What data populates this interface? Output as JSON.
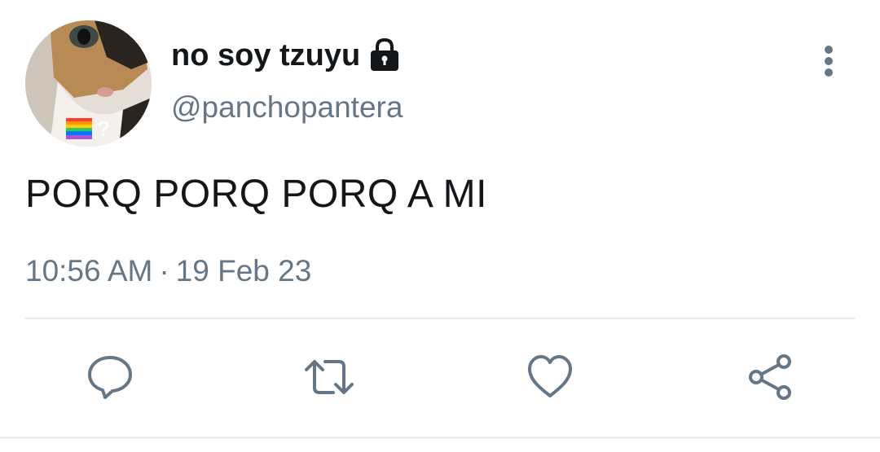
{
  "tweet": {
    "display_name": "no soy tzuyu",
    "handle": "@panchopantera",
    "text": "PORQ PORQ PORQ A MI",
    "time": "10:56 AM",
    "separator": "·",
    "date": "19 Feb 23",
    "avatar_badge": "?"
  },
  "icons": {
    "lock": "lock-icon",
    "more": "more-vertical-icon",
    "reply": "reply-icon",
    "retweet": "retweet-icon",
    "like": "like-icon",
    "share": "share-icon"
  },
  "colors": {
    "text": "#14171a",
    "secondary": "#657786",
    "divider": "#e6ecf0"
  }
}
